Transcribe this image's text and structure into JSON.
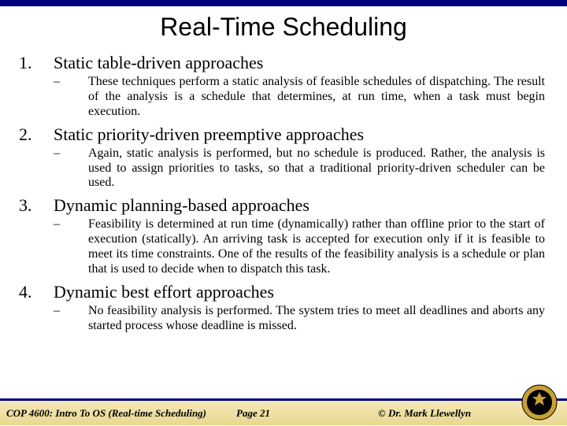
{
  "title": "Real-Time Scheduling",
  "items": [
    {
      "num": "1.",
      "heading": "Static table-driven approaches",
      "desc": "These techniques perform a static analysis of feasible schedules of dispatching.  The result of the analysis is a schedule that determines, at run time, when a task must begin execution."
    },
    {
      "num": "2.",
      "heading": "Static priority-driven preemptive approaches",
      "desc": "Again, static analysis is performed, but no schedule is produced.  Rather, the analysis is used to assign priorities to tasks, so that a traditional priority-driven scheduler can be used."
    },
    {
      "num": "3.",
      "heading": "Dynamic planning-based approaches",
      "desc": "Feasibility is determined at run time (dynamically) rather than offline prior to the start of execution (statically). An arriving task is accepted for execution only if it is feasible to meet its time constraints.  One of the results of the feasibility analysis is a schedule or plan that is used to decide when to dispatch this task."
    },
    {
      "num": "4.",
      "heading": "Dynamic best effort approaches",
      "desc": "No feasibility analysis is performed.  The system tries to meet all deadlines and aborts any started process whose deadline is missed."
    }
  ],
  "footer": {
    "left": "COP 4600: Intro To OS  (Real-time Scheduling)",
    "center": "Page 21",
    "right": "© Dr. Mark Llewellyn"
  }
}
